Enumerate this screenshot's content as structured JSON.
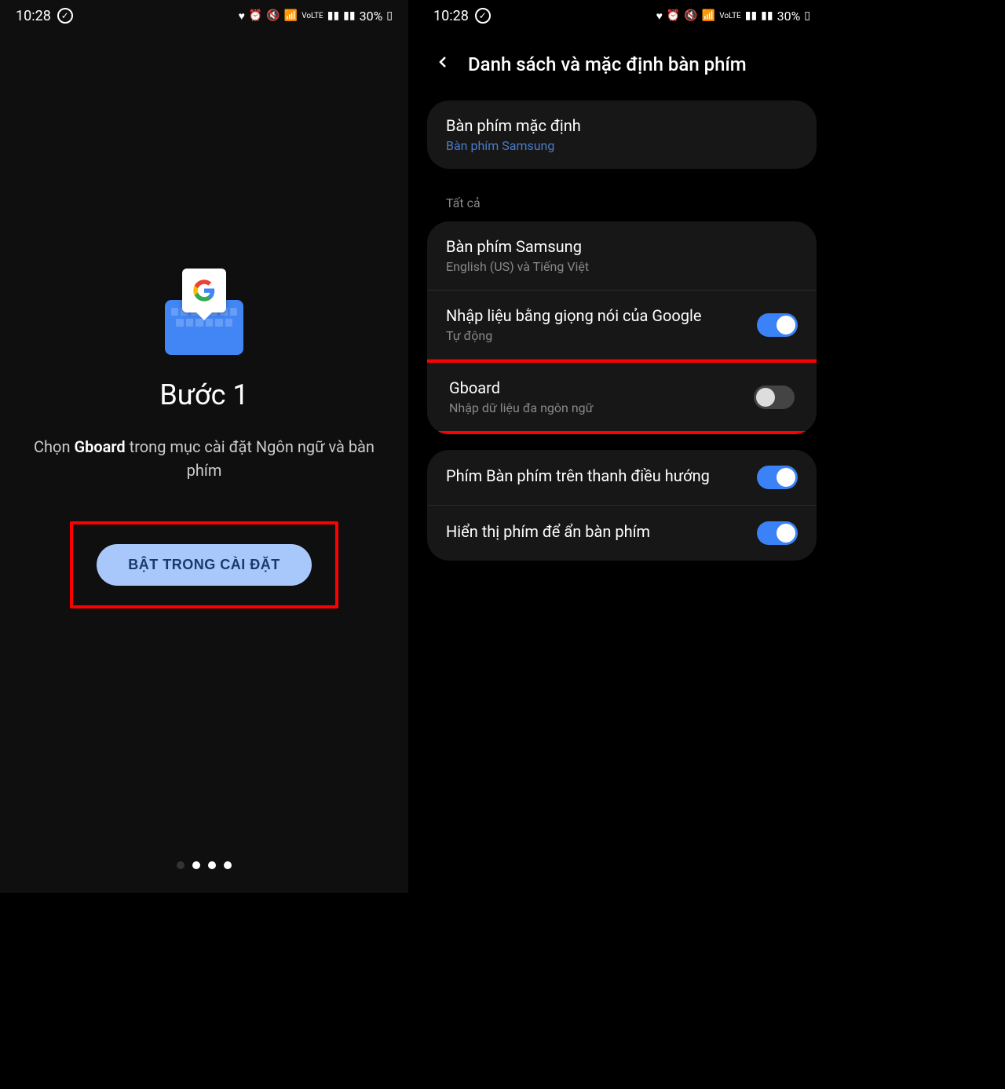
{
  "status": {
    "time": "10:28",
    "battery": "30%"
  },
  "left": {
    "step_title": "Bước 1",
    "desc_prefix": "Chọn ",
    "desc_bold": "Gboard",
    "desc_suffix": " trong mục cài đặt Ngôn ngữ và bàn phím",
    "enable_button": "BẬT TRONG CÀI ĐẶT"
  },
  "right": {
    "header_title": "Danh sách và mặc định bàn phím",
    "default_card": {
      "title": "Bàn phím mặc định",
      "subtitle": "Bàn phím Samsung"
    },
    "section_label": "Tất cả",
    "items": [
      {
        "title": "Bàn phím Samsung",
        "subtitle": "English (US) và Tiếng Việt",
        "has_toggle": false
      },
      {
        "title": "Nhập liệu bằng giọng nói của Google",
        "subtitle": "Tự động",
        "has_toggle": true,
        "toggle_on": true
      },
      {
        "title": "Gboard",
        "subtitle": "Nhập dữ liệu đa ngôn ngữ",
        "has_toggle": true,
        "toggle_on": false,
        "highlighted": true
      }
    ],
    "bottom_items": [
      {
        "title": "Phím Bàn phím trên thanh điều hướng",
        "toggle_on": true
      },
      {
        "title": "Hiển thị phím để ẩn bàn phím",
        "toggle_on": true
      }
    ]
  }
}
